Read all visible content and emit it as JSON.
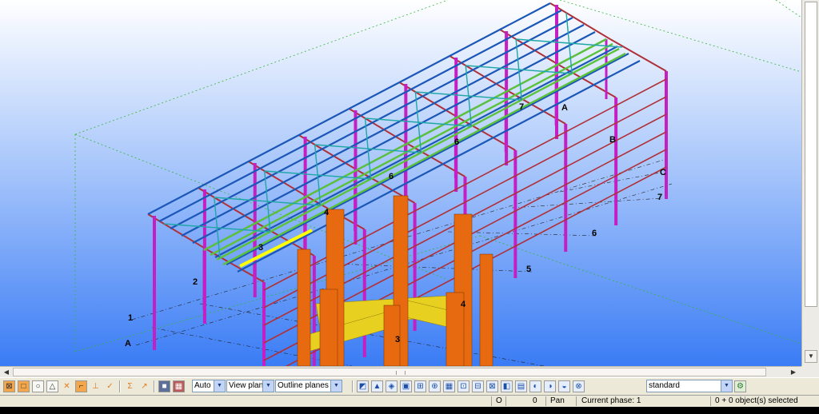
{
  "model": {
    "grid_labels": {
      "near_A": "A",
      "near_1": "1",
      "near_2": "2",
      "near_3": "3",
      "near_4": "4",
      "far_A": "A",
      "far_B": "B",
      "far_C": "C",
      "far_5": "5",
      "far_6": "6",
      "far_7": "7",
      "roof_6a": "6",
      "roof_6b": "6",
      "roof_7": "7",
      "col_3": "3",
      "col_4": "4"
    },
    "colors": {
      "sky_top": "#ffffff",
      "sky_bottom": "#3a7cf5",
      "roof_purlin": "#1b57b8",
      "bracing": "#1fa6a6",
      "truss_green": "#5cc23a",
      "column_magenta": "#c41ec4",
      "rail_red": "#b0303a",
      "column_orange": "#e86a10",
      "beam_yellow": "#e8d020",
      "highlight": "#ffff00"
    }
  },
  "toolbar": {
    "icons": [
      "snap-end-icon",
      "snap-center-icon",
      "snap-circle-icon",
      "snap-triangle-icon",
      "snap-cross-icon",
      "snap-square-icon",
      "snap-perp-icon",
      "snap-check-icon",
      "snap-sigma-icon",
      "snap-arrow-icon",
      "render-icon",
      "view-grid-icon"
    ],
    "work_area_select": "Auto",
    "plane_select": "View plane",
    "outline_select": "Outline planes",
    "filter_select": "standard",
    "select_icons": [
      "select-all-icon",
      "select-part-icon",
      "select-weld-icon",
      "select-comp-icon",
      "select-bolt-icon",
      "select-grid-icon",
      "select-point-icon",
      "select-line-icon",
      "select-plane-icon",
      "select-dim-icon",
      "select-view-icon",
      "select-group-icon",
      "select-assembly-icon",
      "select-cut-icon",
      "select-cast-icon",
      "select-rebar-icon"
    ]
  },
  "status": {
    "mode_o": "O",
    "count": "0",
    "pan": "Pan",
    "phase": "Current phase: 1",
    "selection": "0 + 0 object(s) selected"
  }
}
